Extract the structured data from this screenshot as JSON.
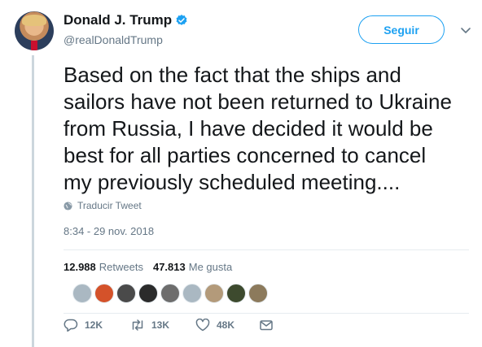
{
  "user": {
    "display_name": "Donald J. Trump",
    "handle": "@realDonaldTrump",
    "verified": true
  },
  "follow_button_label": "Seguir",
  "tweet": {
    "lines": [
      "Based on the fact that the ships and",
      "sailors have not been returned to Ukraine",
      "from Russia, I have decided it would be",
      "best for all parties concerned to cancel",
      "my previously scheduled meeting...."
    ]
  },
  "translate_label": "Traducir Tweet",
  "timestamp": "8:34 - 29 nov. 2018",
  "stats": {
    "retweets_count": "12.988",
    "retweets_label": "Retweets",
    "likes_count": "47.813",
    "likes_label": "Me gusta"
  },
  "liker_avatar_colors": [
    "#aab8c2",
    "#d4522a",
    "#4a4a4a",
    "#2b2b2b",
    "#6d6d6d",
    "#aab8c2",
    "#b39a7a",
    "#3d4a2e",
    "#8c7a5c"
  ],
  "actions": {
    "reply_count": "12K",
    "retweet_count": "13K",
    "like_count": "48K"
  },
  "colors": {
    "accent": "#1da1f2",
    "secondary_text": "#657786",
    "verified": "#1da1f2"
  }
}
